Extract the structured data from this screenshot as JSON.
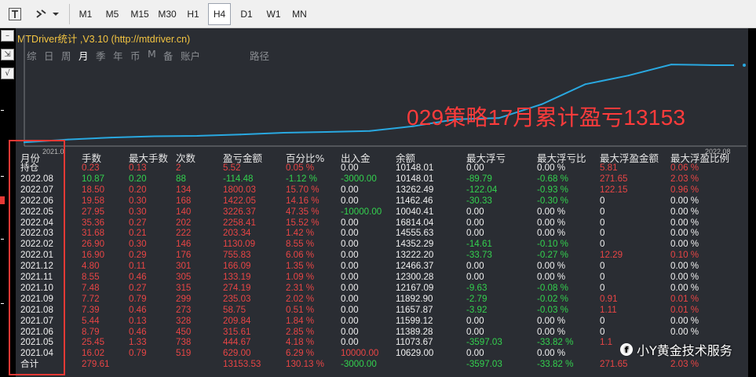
{
  "toolbar": {
    "timeframes": [
      "M1",
      "M5",
      "M15",
      "M30",
      "H1",
      "H4",
      "D1",
      "W1",
      "MN"
    ],
    "active": "H4"
  },
  "panel": {
    "title": "MTDriver统计 ,V3.10 (http://mtdriver.cn)",
    "tabs": [
      "综",
      "日",
      "周",
      "月",
      "季",
      "年",
      "币",
      "M",
      "备",
      "账户",
      "路径"
    ],
    "active_tab": "月",
    "axis_left": "2021.0",
    "axis_right": "2022.08",
    "annotation": "029策略17月累计盈亏13153"
  },
  "colors": {
    "panel_bg": "#2a2d33",
    "curve": "#29a8e0",
    "positive": "#33d14e",
    "negative": "#e84545",
    "title": "#f4c542",
    "highlight_box": "#e53935"
  },
  "table": {
    "headers": [
      "月份",
      "手数",
      "最大手数",
      "次数",
      "盈亏金额",
      "百分比%",
      "出入金",
      "余额",
      "最大浮亏",
      "最大浮亏比",
      "最大浮盈金额",
      "最大浮盈比例"
    ],
    "rows": [
      {
        "label": "持仓",
        "cells": [
          [
            "0.23",
            "r"
          ],
          [
            "0.13",
            "r"
          ],
          [
            "2",
            "r"
          ],
          [
            "5.52",
            "r"
          ],
          [
            "0.05 %",
            "r"
          ],
          [
            "0.00",
            "w"
          ],
          [
            "10148.01",
            "w"
          ],
          [
            "0.00",
            "w"
          ],
          [
            "0.00 %",
            "w"
          ],
          [
            "5.81",
            "r"
          ],
          [
            "0.06 %",
            "r"
          ]
        ]
      },
      {
        "label": "2022.08",
        "cells": [
          [
            "10.87",
            "g"
          ],
          [
            "0.20",
            "g"
          ],
          [
            "88",
            "g"
          ],
          [
            "-114.48",
            "g"
          ],
          [
            "-1.12 %",
            "g"
          ],
          [
            "-3000.00",
            "g"
          ],
          [
            "10148.01",
            "w"
          ],
          [
            "-89.79",
            "g"
          ],
          [
            "-0.68 %",
            "g"
          ],
          [
            "271.65",
            "r"
          ],
          [
            "2.03 %",
            "r"
          ]
        ]
      },
      {
        "label": "2022.07",
        "cells": [
          [
            "18.50",
            "r"
          ],
          [
            "0.20",
            "r"
          ],
          [
            "134",
            "r"
          ],
          [
            "1800.03",
            "r"
          ],
          [
            "15.70 %",
            "r"
          ],
          [
            "0.00",
            "w"
          ],
          [
            "13262.49",
            "w"
          ],
          [
            "-122.04",
            "g"
          ],
          [
            "-0.93 %",
            "g"
          ],
          [
            "122.15",
            "r"
          ],
          [
            "0.96 %",
            "r"
          ]
        ]
      },
      {
        "label": "2022.06",
        "cells": [
          [
            "19.58",
            "r"
          ],
          [
            "0.30",
            "r"
          ],
          [
            "168",
            "r"
          ],
          [
            "1422.05",
            "r"
          ],
          [
            "14.16 %",
            "r"
          ],
          [
            "0.00",
            "w"
          ],
          [
            "11462.46",
            "w"
          ],
          [
            "-30.33",
            "g"
          ],
          [
            "-0.30 %",
            "g"
          ],
          [
            "0",
            "w"
          ],
          [
            "0.00 %",
            "w"
          ]
        ]
      },
      {
        "label": "2022.05",
        "cells": [
          [
            "27.95",
            "r"
          ],
          [
            "0.30",
            "r"
          ],
          [
            "140",
            "r"
          ],
          [
            "3226.37",
            "r"
          ],
          [
            "47.35 %",
            "r"
          ],
          [
            "-10000.00",
            "g"
          ],
          [
            "10040.41",
            "w"
          ],
          [
            "0.00",
            "w"
          ],
          [
            "0.00 %",
            "w"
          ],
          [
            "0",
            "w"
          ],
          [
            "0.00 %",
            "w"
          ]
        ]
      },
      {
        "label": "2022.04",
        "cells": [
          [
            "35.36",
            "r"
          ],
          [
            "0.27",
            "r"
          ],
          [
            "202",
            "r"
          ],
          [
            "2258.41",
            "r"
          ],
          [
            "15.52 %",
            "r"
          ],
          [
            "0.00",
            "w"
          ],
          [
            "16814.04",
            "w"
          ],
          [
            "0.00",
            "w"
          ],
          [
            "0.00 %",
            "w"
          ],
          [
            "0",
            "w"
          ],
          [
            "0.00 %",
            "w"
          ]
        ]
      },
      {
        "label": "2022.03",
        "cells": [
          [
            "31.68",
            "r"
          ],
          [
            "0.21",
            "r"
          ],
          [
            "222",
            "r"
          ],
          [
            "203.34",
            "r"
          ],
          [
            "1.42 %",
            "r"
          ],
          [
            "0.00",
            "w"
          ],
          [
            "14555.63",
            "w"
          ],
          [
            "0.00",
            "w"
          ],
          [
            "0.00 %",
            "w"
          ],
          [
            "0",
            "w"
          ],
          [
            "0.00 %",
            "w"
          ]
        ]
      },
      {
        "label": "2022.02",
        "cells": [
          [
            "26.90",
            "r"
          ],
          [
            "0.30",
            "r"
          ],
          [
            "146",
            "r"
          ],
          [
            "1130.09",
            "r"
          ],
          [
            "8.55 %",
            "r"
          ],
          [
            "0.00",
            "w"
          ],
          [
            "14352.29",
            "w"
          ],
          [
            "-14.61",
            "g"
          ],
          [
            "-0.10 %",
            "g"
          ],
          [
            "0",
            "w"
          ],
          [
            "0.00 %",
            "w"
          ]
        ]
      },
      {
        "label": "2022.01",
        "cells": [
          [
            "16.90",
            "r"
          ],
          [
            "0.29",
            "r"
          ],
          [
            "176",
            "r"
          ],
          [
            "755.83",
            "r"
          ],
          [
            "6.06 %",
            "r"
          ],
          [
            "0.00",
            "w"
          ],
          [
            "13222.20",
            "w"
          ],
          [
            "-33.73",
            "g"
          ],
          [
            "-0.27 %",
            "g"
          ],
          [
            "12.29",
            "r"
          ],
          [
            "0.10 %",
            "r"
          ]
        ]
      },
      {
        "label": "2021.12",
        "cells": [
          [
            "4.80",
            "r"
          ],
          [
            "0.11",
            "r"
          ],
          [
            "301",
            "r"
          ],
          [
            "166.09",
            "r"
          ],
          [
            "1.35 %",
            "r"
          ],
          [
            "0.00",
            "w"
          ],
          [
            "12466.37",
            "w"
          ],
          [
            "0.00",
            "w"
          ],
          [
            "0.00 %",
            "w"
          ],
          [
            "0",
            "w"
          ],
          [
            "0.00 %",
            "w"
          ]
        ]
      },
      {
        "label": "2021.11",
        "cells": [
          [
            "8.55",
            "r"
          ],
          [
            "0.46",
            "r"
          ],
          [
            "305",
            "r"
          ],
          [
            "133.19",
            "r"
          ],
          [
            "1.09 %",
            "r"
          ],
          [
            "0.00",
            "w"
          ],
          [
            "12300.28",
            "w"
          ],
          [
            "0.00",
            "w"
          ],
          [
            "0.00 %",
            "w"
          ],
          [
            "0",
            "w"
          ],
          [
            "0.00 %",
            "w"
          ]
        ]
      },
      {
        "label": "2021.10",
        "cells": [
          [
            "7.48",
            "r"
          ],
          [
            "0.27",
            "r"
          ],
          [
            "315",
            "r"
          ],
          [
            "274.19",
            "r"
          ],
          [
            "2.31 %",
            "r"
          ],
          [
            "0.00",
            "w"
          ],
          [
            "12167.09",
            "w"
          ],
          [
            "-9.63",
            "g"
          ],
          [
            "-0.08 %",
            "g"
          ],
          [
            "0",
            "w"
          ],
          [
            "0.00 %",
            "w"
          ]
        ]
      },
      {
        "label": "2021.09",
        "cells": [
          [
            "7.72",
            "r"
          ],
          [
            "0.79",
            "r"
          ],
          [
            "299",
            "r"
          ],
          [
            "235.03",
            "r"
          ],
          [
            "2.02 %",
            "r"
          ],
          [
            "0.00",
            "w"
          ],
          [
            "11892.90",
            "w"
          ],
          [
            "-2.79",
            "g"
          ],
          [
            "-0.02 %",
            "g"
          ],
          [
            "0.91",
            "r"
          ],
          [
            "0.01 %",
            "r"
          ]
        ]
      },
      {
        "label": "2021.08",
        "cells": [
          [
            "7.39",
            "r"
          ],
          [
            "0.46",
            "r"
          ],
          [
            "273",
            "r"
          ],
          [
            "58.75",
            "r"
          ],
          [
            "0.51 %",
            "r"
          ],
          [
            "0.00",
            "w"
          ],
          [
            "11657.87",
            "w"
          ],
          [
            "-3.92",
            "g"
          ],
          [
            "-0.03 %",
            "g"
          ],
          [
            "1.11",
            "r"
          ],
          [
            "0.01 %",
            "r"
          ]
        ]
      },
      {
        "label": "2021.07",
        "cells": [
          [
            "5.44",
            "r"
          ],
          [
            "0.13",
            "r"
          ],
          [
            "328",
            "r"
          ],
          [
            "209.84",
            "r"
          ],
          [
            "1.84 %",
            "r"
          ],
          [
            "0.00",
            "w"
          ],
          [
            "11599.12",
            "w"
          ],
          [
            "0.00",
            "w"
          ],
          [
            "0.00 %",
            "w"
          ],
          [
            "0",
            "w"
          ],
          [
            "0.00 %",
            "w"
          ]
        ]
      },
      {
        "label": "2021.06",
        "cells": [
          [
            "8.79",
            "r"
          ],
          [
            "0.46",
            "r"
          ],
          [
            "450",
            "r"
          ],
          [
            "315.61",
            "r"
          ],
          [
            "2.85 %",
            "r"
          ],
          [
            "0.00",
            "w"
          ],
          [
            "11389.28",
            "w"
          ],
          [
            "0.00",
            "w"
          ],
          [
            "0.00 %",
            "w"
          ],
          [
            "0",
            "w"
          ],
          [
            "0.00 %",
            "w"
          ]
        ]
      },
      {
        "label": "2021.05",
        "cells": [
          [
            "25.45",
            "r"
          ],
          [
            "1.33",
            "r"
          ],
          [
            "738",
            "r"
          ],
          [
            "444.67",
            "r"
          ],
          [
            "4.18 %",
            "r"
          ],
          [
            "0.00",
            "w"
          ],
          [
            "11073.67",
            "w"
          ],
          [
            "-3597.03",
            "g"
          ],
          [
            "-33.82 %",
            "g"
          ],
          [
            "1.1",
            "r"
          ],
          [
            "",
            "w"
          ]
        ]
      },
      {
        "label": "2021.04",
        "cells": [
          [
            "16.02",
            "r"
          ],
          [
            "0.79",
            "r"
          ],
          [
            "519",
            "r"
          ],
          [
            "629.00",
            "r"
          ],
          [
            "6.29 %",
            "r"
          ],
          [
            "10000.00",
            "r"
          ],
          [
            "10629.00",
            "w"
          ],
          [
            "0.00",
            "w"
          ],
          [
            "0.00 %",
            "w"
          ],
          [
            "",
            "w"
          ],
          [
            "",
            "w"
          ]
        ]
      },
      {
        "label": "合计",
        "cells": [
          [
            "279.61",
            "r"
          ],
          [
            "",
            "w"
          ],
          [
            "",
            "w"
          ],
          [
            "13153.53",
            "r"
          ],
          [
            "130.13 %",
            "r"
          ],
          [
            "-3000.00",
            "g"
          ],
          [
            "",
            "w"
          ],
          [
            "-3597.03",
            "g"
          ],
          [
            "-33.82 %",
            "g"
          ],
          [
            "271.65",
            "r"
          ],
          [
            "2.03 %",
            "r"
          ]
        ]
      }
    ]
  },
  "chart_data": {
    "type": "line",
    "x": [
      "2021.04",
      "2021.05",
      "2021.06",
      "2021.07",
      "2021.08",
      "2021.09",
      "2021.10",
      "2021.11",
      "2021.12",
      "2022.01",
      "2022.02",
      "2022.03",
      "2022.04",
      "2022.05",
      "2022.06",
      "2022.07",
      "2022.08"
    ],
    "series": [
      {
        "values": [
          10629.0,
          11073.67,
          11389.28,
          11599.12,
          11657.87,
          11892.9,
          12167.09,
          12300.28,
          12466.37,
          13222.2,
          14352.29,
          14555.63,
          16814.04,
          20040.41,
          21462.46,
          23262.49,
          23148.01
        ]
      }
    ],
    "tick_labels": [
      "2021.0",
      "2022.08"
    ]
  },
  "watermark": "小Y黄金技术服务"
}
